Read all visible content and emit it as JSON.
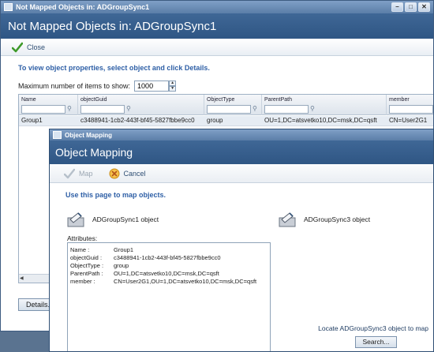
{
  "back_window": {
    "titlebar": "Not Mapped Objects in: ADGroupSync1",
    "banner_title": "Not Mapped Objects in: ADGroupSync1",
    "close_label": "Close",
    "instruction": "To view object properties, select object and click Details.",
    "max_items_label": "Maximum number of items to show:",
    "max_items_value": "1000",
    "columns": [
      "Name",
      "objectGuid",
      "ObjectType",
      "ParentPath",
      "member"
    ],
    "row": {
      "name": "Group1",
      "guid": "c3488941-1cb2-443f-bf45-5827fbbe9cc0",
      "type": "group",
      "parent": "OU=1,DC=atsvetko10,DC=msk,DC=qsft",
      "member": "CN=User2G1"
    },
    "details_label": "Details..."
  },
  "dialog": {
    "titlebar": "Object Mapping",
    "banner_title": "Object Mapping",
    "map_label": "Map",
    "cancel_label": "Cancel",
    "instruction": "Use this page to map objects.",
    "source_object": "ADGroupSync1 object",
    "target_object": "ADGroupSync3 object",
    "attributes_label": "Attributes:",
    "attributes": [
      {
        "key": "Name :",
        "value": "Group1"
      },
      {
        "key": "objectGuid :",
        "value": "c3488941-1cb2-443f-bf45-5827fbbe9cc0"
      },
      {
        "key": "ObjectType :",
        "value": "group"
      },
      {
        "key": "ParentPath :",
        "value": "OU=1,DC=atsvetko10,DC=msk,DC=qsft"
      },
      {
        "key": "member :",
        "value": "CN=User2G1,OU=1,DC=atsvetko10,DC=msk,DC=qsft"
      }
    ],
    "locate_label": "Locate ADGroupSync3 object to map",
    "search_label": "Search..."
  },
  "colors": {
    "accent": "#2e5fa6",
    "banner": "#3a628f",
    "titlebar": "#6f91bb"
  }
}
